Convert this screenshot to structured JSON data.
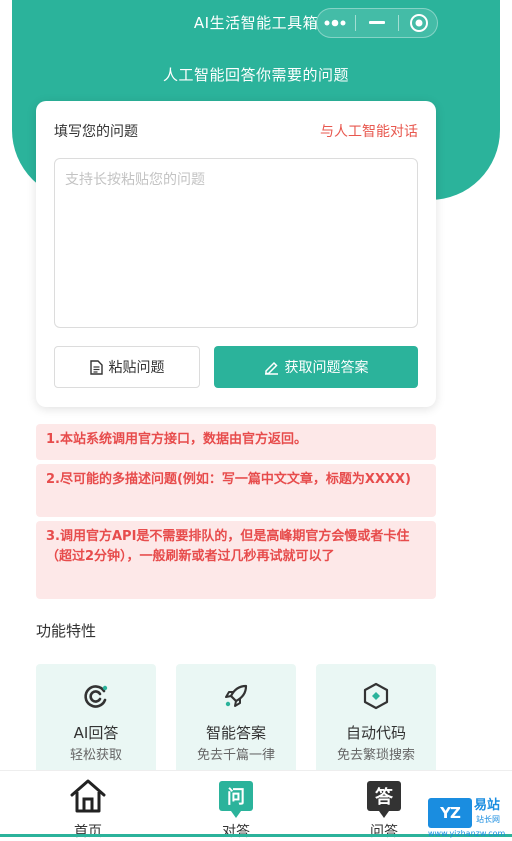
{
  "header": {
    "title": "AI生活智能工具箱",
    "subtitle": "人工智能回答你需要的问题",
    "accent_color": "#2bb39b",
    "capsule_icons": [
      "more-dots-icon",
      "minimize-icon",
      "close-circle-icon"
    ]
  },
  "card": {
    "label": "填写您的问题",
    "link": "与人工智能对话",
    "placeholder": "支持长按粘贴您的问题",
    "paste_button": "粘贴问题",
    "paste_icon": "document-icon",
    "get_button": "获取问题答案",
    "get_icon": "edit-pen-icon"
  },
  "notices": [
    "1.本站系统调用官方接口，数据由官方返回。",
    "2.尽可能的多描述问题(例如：写一篇中文文章，标题为XXXX)",
    "3.调用官方API是不需要排队的，但是高峰期官方会慢或者卡住（超过2分钟），一般刷新或者过几秒再试就可以了"
  ],
  "features": {
    "title": "功能特性",
    "items": [
      {
        "name": "AI回答",
        "desc": "轻松获取",
        "icon": "ai-swirl-icon"
      },
      {
        "name": "智能答案",
        "desc": "免去千篇一律",
        "icon": "rocket-icon"
      },
      {
        "name": "自动代码",
        "desc": "免去繁琐搜索",
        "icon": "hexagon-code-icon"
      }
    ]
  },
  "tabbar": {
    "items": [
      {
        "label": "首页",
        "icon": "home-icon"
      },
      {
        "label": "对答",
        "icon": "wen-chat-icon",
        "glyph": "问"
      },
      {
        "label": "问答",
        "icon": "da-chat-icon",
        "glyph": "答"
      }
    ]
  },
  "watermark": {
    "logo": "YZ",
    "brand": "易站",
    "brand_sub": "站长网",
    "url": "www.yizhanzw.com"
  }
}
